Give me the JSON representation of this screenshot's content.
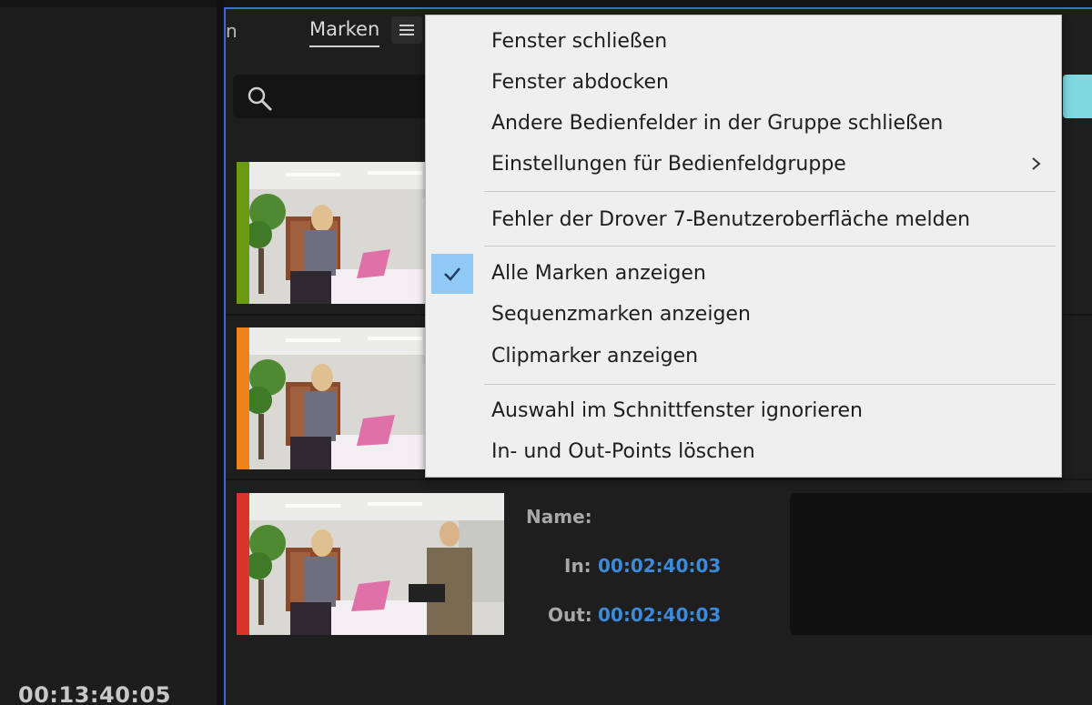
{
  "left_panel": {
    "timecode": "00:13:40:05"
  },
  "tabs": {
    "partial_tab": "n",
    "marken": "Marken"
  },
  "icons": {
    "menu": "hamburger-icon",
    "search": "search-icon",
    "submenu": "chevron-right-icon",
    "check": "checkmark-icon"
  },
  "context_menu": {
    "items": [
      "Fenster schließen",
      "Fenster abdocken",
      "Andere Bedienfelder in der Gruppe schließen",
      "Einstellungen für Bedienfeldgruppe",
      "Fehler der Drover 7-Benutzeroberfläche melden",
      "Alle Marken anzeigen",
      "Sequenzmarken anzeigen",
      "Clipmarker anzeigen",
      "Auswahl im Schnittfenster ignorieren",
      "In- und Out-Points löschen"
    ],
    "checked_item": "Alle Marken anzeigen"
  },
  "markers": [
    {
      "color": "#6b9a13"
    },
    {
      "color": "#f0821a"
    },
    {
      "color": "#d8352c",
      "name_label": "Name:",
      "in_label": "In:",
      "in_value": "00:02:40:03",
      "out_label": "Out:",
      "out_value": "00:02:40:03"
    }
  ],
  "colors": {
    "accent_blue": "#3d8ad8",
    "check_highlight": "#90c8f6",
    "search_accent": "#7fd7e0"
  }
}
